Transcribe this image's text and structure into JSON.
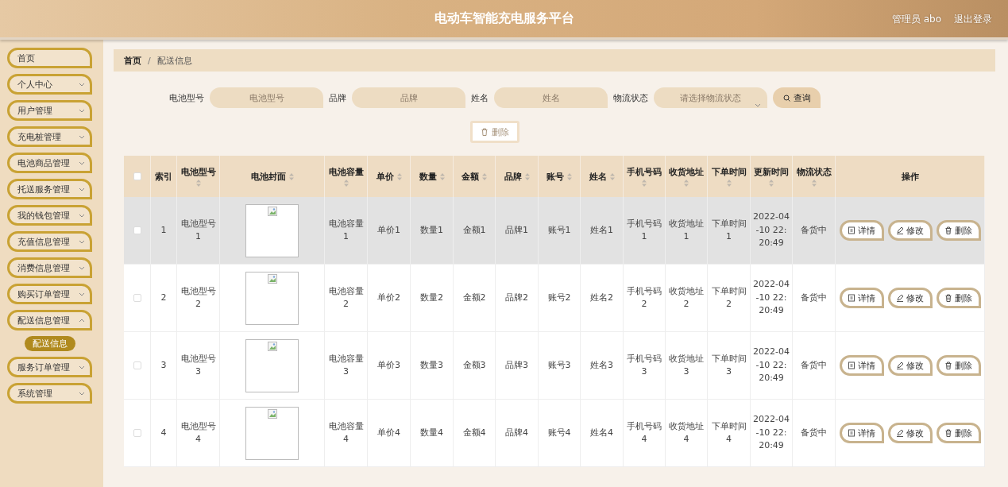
{
  "header": {
    "title": "电动车智能充电服务平台",
    "user": "管理员 abo",
    "logout": "退出登录"
  },
  "sidebar": {
    "items": [
      {
        "label": "首页",
        "kind": "link"
      },
      {
        "label": "个人中心",
        "kind": "group",
        "expanded": false
      },
      {
        "label": "用户管理",
        "kind": "group",
        "expanded": false
      },
      {
        "label": "充电桩管理",
        "kind": "group",
        "expanded": false
      },
      {
        "label": "电池商品管理",
        "kind": "group",
        "expanded": false
      },
      {
        "label": "托送服务管理",
        "kind": "group",
        "expanded": false
      },
      {
        "label": "我的钱包管理",
        "kind": "group",
        "expanded": false
      },
      {
        "label": "充值信息管理",
        "kind": "group",
        "expanded": false
      },
      {
        "label": "消费信息管理",
        "kind": "group",
        "expanded": false
      },
      {
        "label": "购买订单管理",
        "kind": "group",
        "expanded": false
      },
      {
        "label": "配送信息管理",
        "kind": "group",
        "expanded": true,
        "children": [
          {
            "label": "配送信息",
            "selected": true
          }
        ]
      },
      {
        "label": "服务订单管理",
        "kind": "group",
        "expanded": false
      },
      {
        "label": "系统管理",
        "kind": "group",
        "expanded": false
      }
    ]
  },
  "breadcrumb": [
    "首页",
    "配送信息"
  ],
  "breadcrumb_separator": "/",
  "search": {
    "fields": [
      {
        "label": "电池型号",
        "placeholder": "电池型号",
        "kind": "input"
      },
      {
        "label": "品牌",
        "placeholder": "品牌",
        "kind": "input"
      },
      {
        "label": "姓名",
        "placeholder": "姓名",
        "kind": "input"
      },
      {
        "label": "物流状态",
        "placeholder": "请选择物流状态",
        "kind": "select"
      }
    ],
    "button": "查询"
  },
  "bulk_delete": {
    "label": "删除",
    "disabled": true
  },
  "table": {
    "all_checked": false,
    "columns": [
      {
        "label": "索引",
        "sortable": false
      },
      {
        "label": "电池型号",
        "sortable": true
      },
      {
        "label": "电池封面",
        "sortable": true
      },
      {
        "label": "电池容量",
        "sortable": true
      },
      {
        "label": "单价",
        "sortable": true
      },
      {
        "label": "数量",
        "sortable": true
      },
      {
        "label": "金额",
        "sortable": true
      },
      {
        "label": "品牌",
        "sortable": true
      },
      {
        "label": "账号",
        "sortable": true
      },
      {
        "label": "姓名",
        "sortable": true
      },
      {
        "label": "手机号码",
        "sortable": true
      },
      {
        "label": "收货地址",
        "sortable": true
      },
      {
        "label": "下单时间",
        "sortable": true
      },
      {
        "label": "更新时间",
        "sortable": true
      },
      {
        "label": "物流状态",
        "sortable": true
      },
      {
        "label": "操作",
        "sortable": false
      }
    ],
    "rows": [
      {
        "checked": false,
        "hovered": true,
        "cells": [
          "1",
          "电池型号1",
          null,
          "电池容量1",
          "单价1",
          "数量1",
          "金额1",
          "品牌1",
          "账号1",
          "姓名1",
          "手机号码1",
          "收货地址1",
          "下单时间1",
          "2022-04-10 22:20:49",
          "备货中"
        ],
        "actions": [
          "详情",
          "修改",
          "删除"
        ]
      },
      {
        "checked": false,
        "hovered": false,
        "cells": [
          "2",
          "电池型号2",
          null,
          "电池容量2",
          "单价2",
          "数量2",
          "金额2",
          "品牌2",
          "账号2",
          "姓名2",
          "手机号码2",
          "收货地址2",
          "下单时间2",
          "2022-04-10 22:20:49",
          "备货中"
        ],
        "actions": [
          "详情",
          "修改",
          "删除"
        ]
      },
      {
        "checked": false,
        "hovered": false,
        "cells": [
          "3",
          "电池型号3",
          null,
          "电池容量3",
          "单价3",
          "数量3",
          "金额3",
          "品牌3",
          "账号3",
          "姓名3",
          "手机号码3",
          "收货地址3",
          "下单时间3",
          "2022-04-10 22:20:49",
          "备货中"
        ],
        "actions": [
          "详情",
          "修改",
          "删除"
        ]
      },
      {
        "checked": false,
        "hovered": false,
        "cells": [
          "4",
          "电池型号4",
          null,
          "电池容量4",
          "单价4",
          "数量4",
          "金额4",
          "品牌4",
          "账号4",
          "姓名4",
          "手机号码4",
          "收货地址4",
          "下单时间4",
          "2022-04-10 22:20:49",
          "备货中"
        ],
        "actions": [
          "详情",
          "修改",
          "删除"
        ]
      }
    ]
  }
}
